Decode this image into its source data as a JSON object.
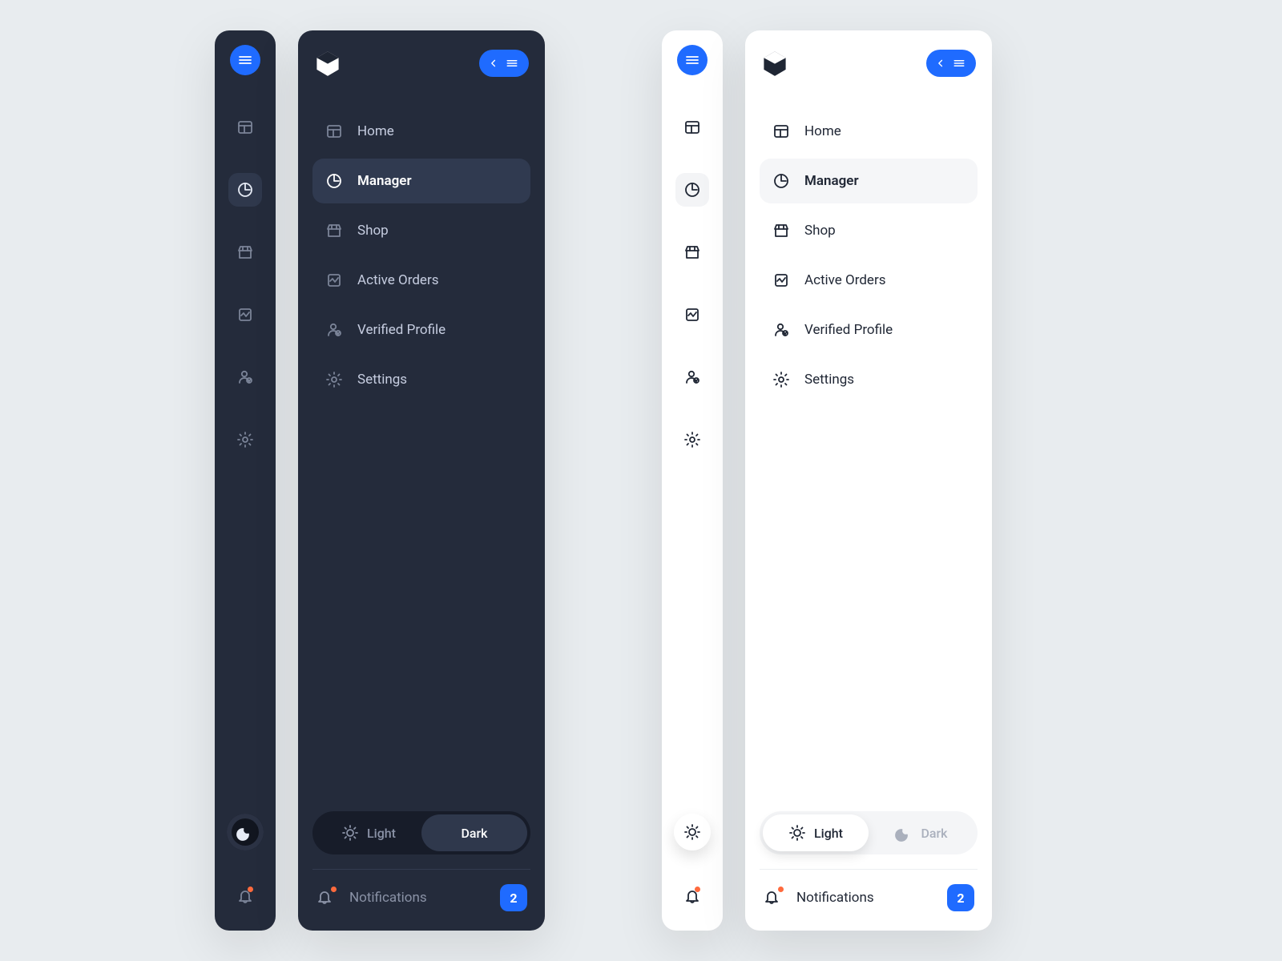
{
  "nav": {
    "items": [
      {
        "icon": "home",
        "label": "Home"
      },
      {
        "icon": "manager",
        "label": "Manager"
      },
      {
        "icon": "shop",
        "label": "Shop"
      },
      {
        "icon": "orders",
        "label": "Active Orders"
      },
      {
        "icon": "profile",
        "label": "Verified Profile"
      },
      {
        "icon": "settings",
        "label": "Settings"
      }
    ],
    "active_index": 1
  },
  "theme": {
    "light_label": "Light",
    "dark_label": "Dark",
    "dark_panel_selected": "dark",
    "light_panel_selected": "light"
  },
  "notifications": {
    "label": "Notifications",
    "count": "2"
  }
}
